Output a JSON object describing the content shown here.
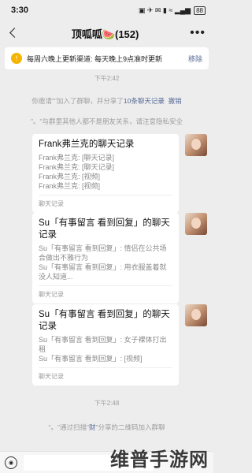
{
  "status": {
    "time": "3:30",
    "icons": "▣ ✈ ✉ ▮ ≈ ▂▄▆",
    "battery": "88"
  },
  "header": {
    "title": "顶呱呱🍉(152)",
    "more": "•••"
  },
  "notice": {
    "icon": "!",
    "text": "每周六晚上更新渠道: 每天晚上9点准时更新",
    "action": "移除"
  },
  "events": {
    "time1": "下午2:42",
    "sys1_prefix": "你邀请\"",
    "sys1_middle": "\"加入了群聊，并分享了",
    "sys1_link": "10条聊天记录",
    "sys1_action": "撤销",
    "sys2": "\"。\"与群里其他人都不是朋友关系，请注意隐私安全",
    "time2": "下午2:48",
    "sys3": "\"。\"通过扫描\"",
    "sys3_name": "财",
    "sys3_suffix": "\"分享的二维码加入群聊"
  },
  "messages": [
    {
      "title": "Frank弗兰克的聊天记录",
      "lines": [
        "Frank弗兰克: [聊天记录]",
        "Frank弗兰克: [聊天记录]",
        "Frank弗兰克: [视频]",
        "Frank弗兰克: [视频]"
      ],
      "footer": "聊天记录"
    },
    {
      "title": "Su「有事留言 看到回复」的聊天记录",
      "lines": [
        "Su「有事留言 看到回复」: 情侣在公共场合做出不雅行为",
        "Su「有事留言 看到回复」: 用衣服盖着就没人知道..."
      ],
      "footer": "聊天记录"
    },
    {
      "title": "Su「有事留言 看到回复」的聊天记录",
      "lines": [
        "Su「有事留言 看到回复」: 女子裸体打出租",
        "Su「有事留言 看到回复」: [视频]"
      ],
      "footer": "聊天记录"
    }
  ],
  "input": {
    "voice_icon": "voice-icon"
  },
  "watermark": "维普手游网"
}
